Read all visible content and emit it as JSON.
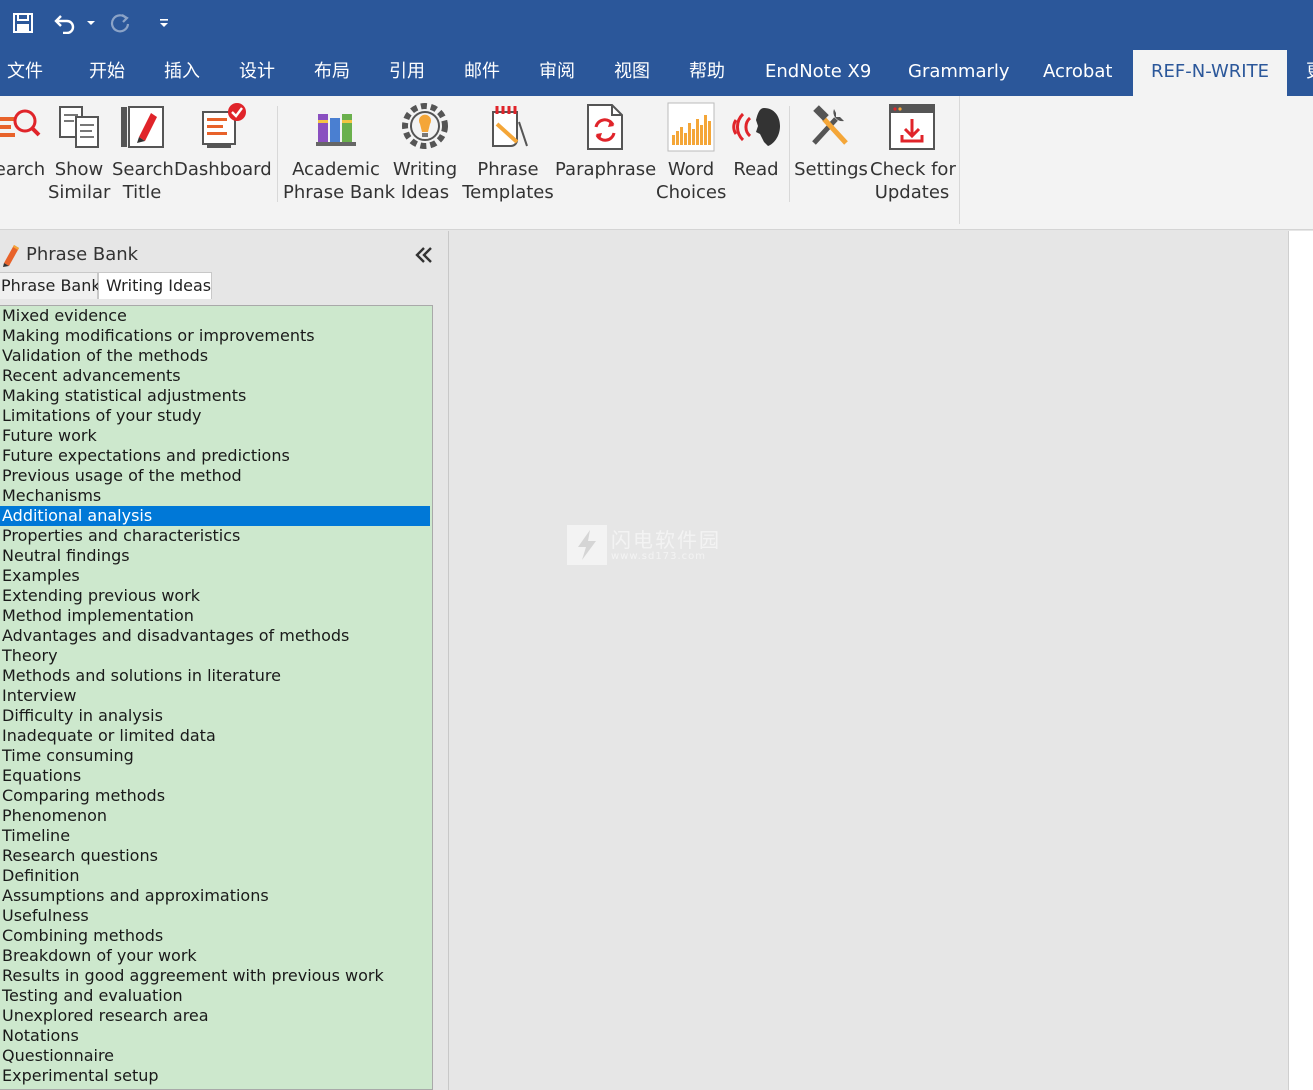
{
  "titlebar": {
    "qat": [
      "save-icon",
      "undo-icon",
      "undo-dropdown-icon",
      "redo-icon",
      "customize-qat-icon"
    ],
    "color": "#2b579a"
  },
  "tabs": [
    {
      "label": "文件"
    },
    {
      "label": "开始"
    },
    {
      "label": "插入"
    },
    {
      "label": "设计"
    },
    {
      "label": "布局"
    },
    {
      "label": "引用"
    },
    {
      "label": "邮件"
    },
    {
      "label": "审阅"
    },
    {
      "label": "视图"
    },
    {
      "label": "帮助"
    },
    {
      "label": "EndNote X9"
    },
    {
      "label": "Grammarly"
    },
    {
      "label": "Acrobat"
    },
    {
      "label": "REF-N-WRITE",
      "active": true
    },
    {
      "label": "更"
    }
  ],
  "ribbon": {
    "buttons": [
      {
        "line1": "earch",
        "line2": "",
        "icon": "search-icon"
      },
      {
        "line1": "Show",
        "line2": "Similar",
        "icon": "show-similar-icon"
      },
      {
        "line1": "Search",
        "line2": "Title",
        "icon": "search-title-icon"
      },
      {
        "line1": "Dashboard",
        "line2": "",
        "icon": "dashboard-icon"
      },
      {
        "line1": "Academic",
        "line2": "Phrase Bank",
        "icon": "books-icon"
      },
      {
        "line1": "Writing",
        "line2": "Ideas",
        "icon": "lightbulb-gear-icon"
      },
      {
        "line1": "Phrase",
        "line2": "Templates",
        "icon": "templates-icon"
      },
      {
        "line1": "Paraphrase",
        "line2": "",
        "icon": "paraphrase-icon"
      },
      {
        "line1": "Word",
        "line2": "Choices",
        "icon": "word-choices-icon"
      },
      {
        "line1": "Read",
        "line2": "",
        "icon": "read-aloud-icon"
      },
      {
        "line1": "Settings",
        "line2": "",
        "icon": "settings-tools-icon"
      },
      {
        "line1": "Check for",
        "line2": "Updates",
        "icon": "download-update-icon"
      }
    ]
  },
  "pane": {
    "title": "Phrase Bank",
    "tabs": [
      "Phrase Bank",
      "Writing Ideas"
    ],
    "active_tab": 1,
    "selected_index": 10,
    "items": [
      "Mixed evidence",
      "Making modifications or improvements",
      "Validation of the methods",
      "Recent advancements",
      "Making statistical adjustments",
      "Limitations of your study",
      "Future work",
      "Future expectations and predictions",
      "Previous usage of the method",
      "Mechanisms",
      "Additional analysis",
      "Properties and characteristics",
      "Neutral findings",
      "Examples",
      "Extending previous work",
      "Method implementation",
      "Advantages and disadvantages of methods",
      "Theory",
      "Methods and solutions in literature",
      "Interview",
      "Difficulty in analysis",
      "Inadequate or limited data",
      "Time consuming",
      "Equations",
      "Comparing methods",
      "Phenomenon",
      "Timeline",
      "Research questions",
      "Definition",
      "Assumptions and approximations",
      "Usefulness",
      "Combining methods",
      "Breakdown of your work",
      "Results in good aggreement with previous work",
      "Testing and evaluation",
      "Unexplored research area",
      "Notations",
      "Questionnaire",
      "Experimental setup"
    ],
    "list_bg": "#cde8cd",
    "selection_color": "#0078d7"
  },
  "watermark": {
    "text": "闪电软件园",
    "url": "www.sd173.com"
  }
}
